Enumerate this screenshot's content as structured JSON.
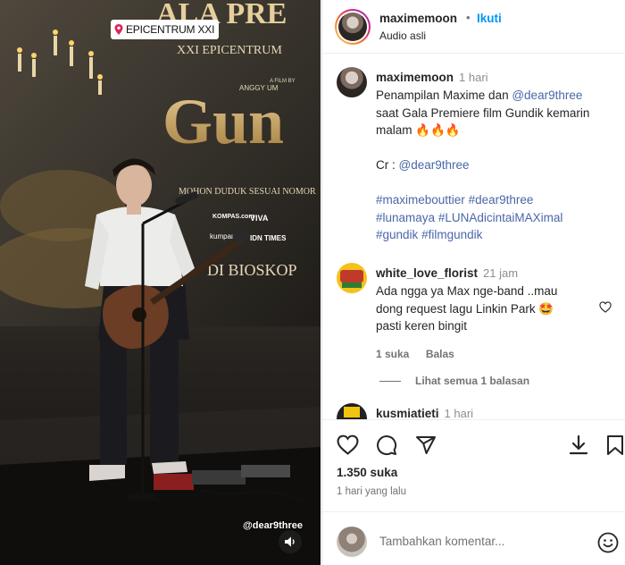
{
  "media": {
    "location_tag": "EPICENTRUM XXI",
    "credit_tag": "@dear9three",
    "poster": {
      "title_top": "ALA PRE",
      "venue": "XXI EPICENTRUM",
      "film_by": "A FILM BY",
      "director": "ANGGY UM",
      "title": "Gun",
      "notice": "MOHON DUDUK SESUAI NOMOR",
      "now_showing": "DI BIOSKOP",
      "sponsors": [
        "KOMPAS.com",
        "VIVA",
        "kumparan",
        "IDN TIMES"
      ]
    }
  },
  "header": {
    "username": "maximemoon",
    "follow_label": "Ikuti",
    "audio_label": "Audio asli"
  },
  "caption": {
    "username": "maximemoon",
    "time": "1 hari",
    "line1_pre": "Penampilan Maxime dan ",
    "line1_mention": "@dear9three",
    "line2": "saat Gala Premiere film Gundik kemarin",
    "line3": "malam 🔥🔥🔥",
    "credit_label": "Cr : ",
    "credit_mention": "@dear9three",
    "hashtags": [
      "#maximebouttier",
      "#dear9three",
      "#lunamaya",
      "#LUNAdicintaiMAXimal",
      "#gundik",
      "#filmgundik"
    ]
  },
  "comment1": {
    "username": "white_love_florist",
    "time": "21 jam",
    "line1": "Ada ngga ya Max nge-band ..mau",
    "line2": "dong request lagu Linkin Park 🤩",
    "line3": "pasti keren bingit",
    "likes": "1 suka",
    "reply_label": "Balas",
    "view_replies": "Lihat semua 1 balasan"
  },
  "comment2": {
    "username": "kusmiatieti",
    "time": "1 hari"
  },
  "actions": {
    "likes": "1.350 suka",
    "time_ago": "1 hari yang lalu"
  },
  "composer": {
    "placeholder": "Tambahkan komentar..."
  },
  "colors": {
    "link": "#4a67a8",
    "follow": "#0095f6",
    "muted": "#737373"
  }
}
